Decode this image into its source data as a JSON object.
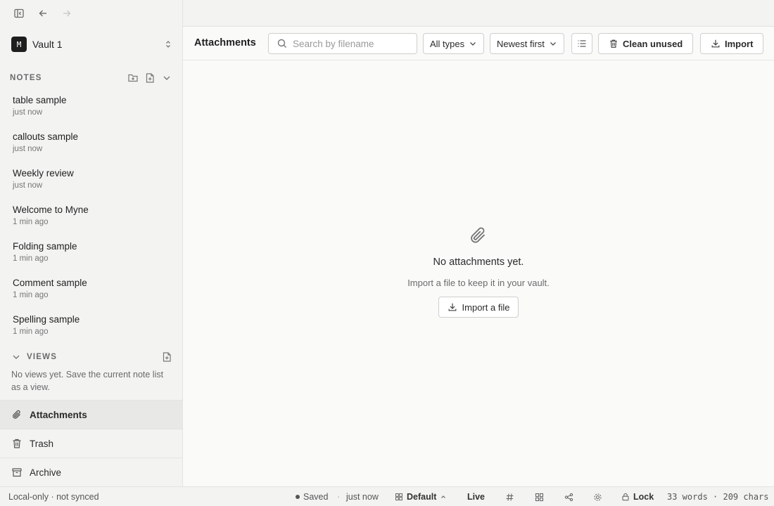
{
  "sidebar": {
    "vault": {
      "initial": "M",
      "name": "Vault 1"
    },
    "notes_section": {
      "label": "NOTES"
    },
    "notes": [
      {
        "title": "table sample",
        "time": "just now"
      },
      {
        "title": "callouts sample",
        "time": "just now"
      },
      {
        "title": "Weekly review",
        "time": "just now"
      },
      {
        "title": "Welcome to Myne",
        "time": "1 min ago"
      },
      {
        "title": "Folding sample",
        "time": "1 min ago"
      },
      {
        "title": "Comment sample",
        "time": "1 min ago"
      },
      {
        "title": "Spelling sample",
        "time": "1 min ago"
      }
    ],
    "views_section": {
      "label": "VIEWS",
      "empty_text": "No views yet. Save the current note list as a view."
    },
    "nav": {
      "attachments": "Attachments",
      "trash": "Trash",
      "archive": "Archive"
    }
  },
  "main": {
    "title": "Attachments",
    "search": {
      "placeholder": "Search by filename",
      "value": ""
    },
    "type_filter": "All types",
    "sort": "Newest first",
    "clean_label": "Clean unused",
    "import_label": "Import",
    "empty": {
      "title": "No attachments yet.",
      "subtitle": "Import a file to keep it in your vault.",
      "button": "Import a file"
    }
  },
  "statusbar": {
    "sync": "Local-only · not synced",
    "saved": "Saved",
    "separator": "·",
    "saved_time": "just now",
    "layout": "Default",
    "live": "Live",
    "lock": "Lock",
    "stats": "33 words · 209 chars"
  }
}
